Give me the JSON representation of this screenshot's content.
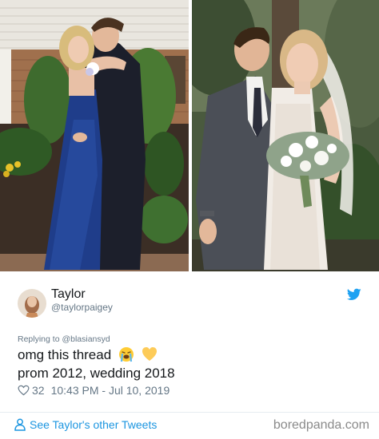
{
  "tweet": {
    "author_name": "Taylor",
    "author_handle": "@taylorpaigey",
    "replying_to": "Replying to @blasiansyd",
    "text_line1": "omg this thread",
    "text_line2": "prom 2012, wedding 2018",
    "likes": "32",
    "timestamp": "10:43 PM - Jul 10, 2019",
    "see_more": "See Taylor's other Tweets"
  },
  "footer": {
    "credit": "boredpanda.com"
  },
  "icons": {
    "bird": "twitter-bird-icon",
    "heart": "heart-icon",
    "person": "person-icon",
    "emoji1": "loudly-crying-face-icon",
    "emoji2": "yellow-heart-icon"
  },
  "colors": {
    "twitter_blue": "#1da1f2",
    "link_blue": "#1b95e0",
    "secondary_text": "#657786",
    "prom_dress": "#1f3d8a"
  }
}
